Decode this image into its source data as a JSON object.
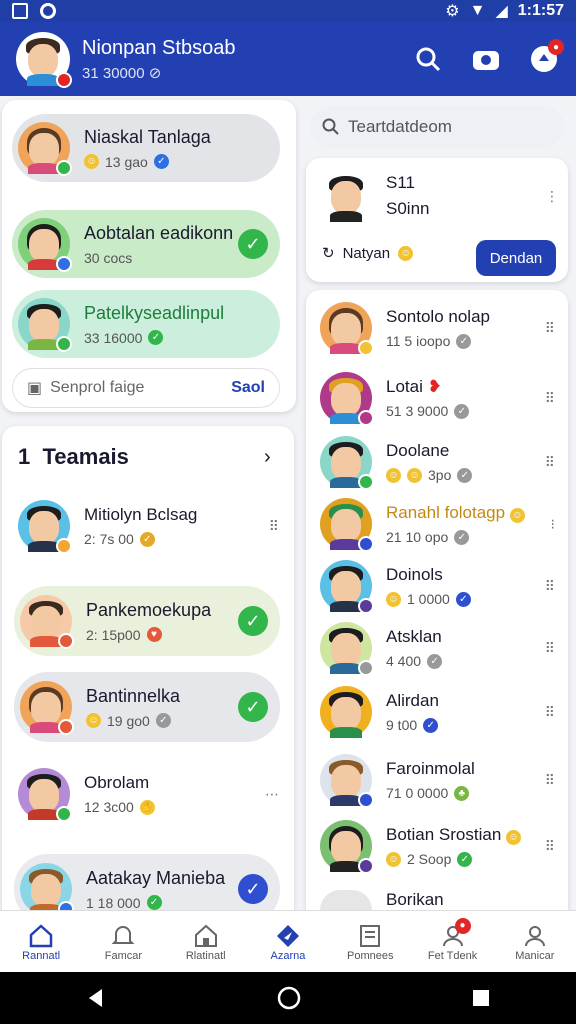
{
  "status": {
    "time": "1:1:57"
  },
  "header": {
    "name": "Nionpan Stbsoab",
    "sub": "31 30000"
  },
  "favorites": [
    {
      "name": "Niaskal Tanlaga",
      "meta": "13 gao",
      "bg": "#e3e4e8"
    },
    {
      "name": "Aobtalan eadikonn",
      "meta": "30 cocs",
      "bg": "#c9ebc7"
    },
    {
      "name": "Patelkyseadlinpul",
      "meta": "33 16000",
      "bg": "#cbeedd"
    }
  ],
  "group_input": {
    "placeholder": "Senprol faige",
    "action": "Saol"
  },
  "teams": {
    "count": "1",
    "title": "Teamais",
    "items": [
      {
        "name": "Mitiolyn Bclsag",
        "meta": "2: 7s 00"
      },
      {
        "name": "Pankemoekupa",
        "meta": "2: 15p00"
      },
      {
        "name": "Bantinnelka",
        "meta": "19 go0"
      },
      {
        "name": "Obrolam",
        "meta": "12 3c00"
      },
      {
        "name": "Aatakay Manieba",
        "meta": "1 18 000"
      }
    ]
  },
  "search": {
    "placeholder": "Teartdatdeom"
  },
  "contact_card": {
    "line1": "S11",
    "line2": "S0inn",
    "status": "Natyan",
    "button": "Dendan"
  },
  "people": [
    {
      "name": "Sontolo nolap",
      "meta": "11 5 ioopo"
    },
    {
      "name": "Lotai",
      "meta": "51 3 9000"
    },
    {
      "name": "Doolane",
      "meta": "3po"
    },
    {
      "name": "Ranahl folotagp",
      "meta": "21 10 opo"
    },
    {
      "name": "Doinols",
      "meta": "1 0000"
    },
    {
      "name": "Atsklan",
      "meta": "4 400"
    },
    {
      "name": "Alirdan",
      "meta": "9 t00"
    },
    {
      "name": "Faroinmolal",
      "meta": "71 0 0000"
    },
    {
      "name": "Botian Srostian",
      "meta": "2 Soop"
    },
    {
      "name": "Borikan",
      "meta": ""
    }
  ],
  "nav": [
    {
      "label": "Rannatl",
      "icon": "home-icon"
    },
    {
      "label": "Famcar",
      "icon": "bell-icon"
    },
    {
      "label": "Rlatinatl",
      "icon": "house-icon"
    },
    {
      "label": "Azarna",
      "icon": "compass-icon"
    },
    {
      "label": "Pomnees",
      "icon": "document-icon"
    },
    {
      "label": "Fet Tdenk",
      "icon": "people-icon"
    },
    {
      "label": "Manicar",
      "icon": "person-icon"
    }
  ],
  "colors": {
    "primary": "#2340b3",
    "green": "#32b54a"
  }
}
